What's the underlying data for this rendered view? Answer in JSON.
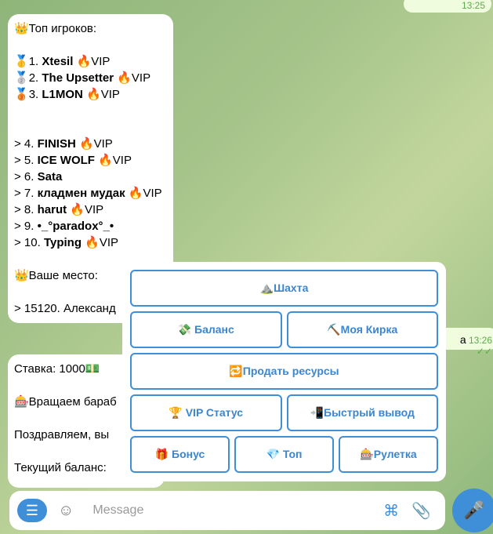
{
  "top_bubble": {
    "time": "13:25"
  },
  "leaderboard": {
    "title": "👑Топ игроков:",
    "top3": [
      {
        "medal": "🥇",
        "num": "1.",
        "name": "Xtesil",
        "tag": "🔥VIP"
      },
      {
        "medal": "🥈",
        "num": "2.",
        "name": "The Upsetter",
        "tag": "🔥VIP"
      },
      {
        "medal": "🥉",
        "num": "3.",
        "name": "L1MON",
        "tag": "🔥VIP"
      }
    ],
    "rest": [
      {
        "num": "> 4.",
        "name": "FINISH",
        "tag": "🔥VIP"
      },
      {
        "num": "> 5.",
        "name": "ICE WOLF",
        "tag": "🔥VIP"
      },
      {
        "num": "> 6.",
        "name": "Sata",
        "tag": ""
      },
      {
        "num": "> 7.",
        "name": "кладмен мудак",
        "tag": "🔥VIP"
      },
      {
        "num": "> 8.",
        "name": "harut",
        "tag": "🔥VIP"
      },
      {
        "num": "> 9.",
        "name": "•_°paradox°_•",
        "tag": ""
      },
      {
        "num": "> 10.",
        "name": "Typing",
        "tag": "🔥VIP"
      }
    ],
    "your_place_label": "👑Ваше место:",
    "your_place": {
      "num": "> 15120.",
      "name": "Александ"
    }
  },
  "outgoing": {
    "text": "а",
    "time": "13:26",
    "ticks": "✓✓"
  },
  "roulette_msg": {
    "lines": [
      "Ставка: 1000💵",
      "🎰Вращаем бараб",
      "Поздравляем, вы",
      "Текущий баланс:"
    ]
  },
  "keyboard": {
    "rows": [
      [
        "⛰️Шахта"
      ],
      [
        "💸 Баланс",
        "⛏️Моя Кирка"
      ],
      [
        "🔁Продать ресурсы"
      ],
      [
        "🏆 VIP Статус",
        "📲Быстрый вывод"
      ],
      [
        "🎁 Бонус",
        "💎 Топ",
        "🎰Рулетка"
      ]
    ]
  },
  "input": {
    "placeholder": "Message",
    "menu_icon": "menu-icon",
    "emoji_icon": "emoji-icon",
    "command_icon": "command-icon",
    "attach_icon": "paperclip-icon",
    "mic_icon": "microphone-icon"
  },
  "colors": {
    "accent": "#3f8ed8",
    "outgoing_bg": "#effdde"
  }
}
